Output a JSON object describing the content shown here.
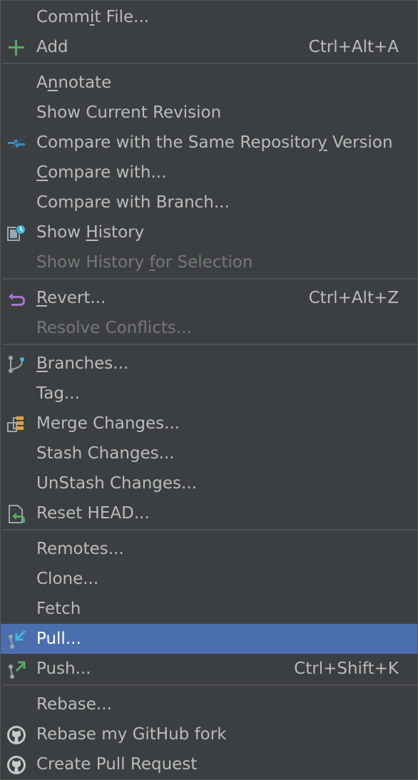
{
  "menu": {
    "commit_file": {
      "label": "Commit File..."
    },
    "add": {
      "label": "Add",
      "shortcut": "Ctrl+Alt+A",
      "icon": "plus-icon"
    },
    "annotate": {
      "label": "Annotate"
    },
    "show_current_revision": {
      "label": "Show Current Revision"
    },
    "compare_same_repo": {
      "label": "Compare with the Same Repository Version",
      "icon": "compare-arrows-icon"
    },
    "compare_with": {
      "label": "Compare with..."
    },
    "compare_with_branch": {
      "label": "Compare with Branch..."
    },
    "show_history": {
      "label": "Show History",
      "icon": "history-icon"
    },
    "show_history_selection": {
      "label": "Show History for Selection",
      "disabled": true
    },
    "revert": {
      "label": "Revert...",
      "shortcut": "Ctrl+Alt+Z",
      "icon": "revert-icon"
    },
    "resolve_conflicts": {
      "label": "Resolve Conflicts...",
      "disabled": true
    },
    "branches": {
      "label": "Branches...",
      "icon": "branch-icon"
    },
    "tag": {
      "label": "Tag..."
    },
    "merge_changes": {
      "label": "Merge Changes...",
      "icon": "merge-icon"
    },
    "stash_changes": {
      "label": "Stash Changes..."
    },
    "unstash_changes": {
      "label": "UnStash Changes..."
    },
    "reset_head": {
      "label": "Reset HEAD...",
      "icon": "reset-icon"
    },
    "remotes": {
      "label": "Remotes..."
    },
    "clone": {
      "label": "Clone..."
    },
    "fetch": {
      "label": "Fetch"
    },
    "pull": {
      "label": "Pull...",
      "selected": true,
      "icon": "pull-icon"
    },
    "push": {
      "label": "Push...",
      "shortcut": "Ctrl+Shift+K",
      "icon": "push-icon"
    },
    "rebase": {
      "label": "Rebase..."
    },
    "rebase_github_fork": {
      "label": "Rebase my GitHub fork",
      "icon": "github-icon"
    },
    "create_pull_request": {
      "label": "Create Pull Request",
      "icon": "github-icon"
    }
  },
  "colors": {
    "background": "#3c3f41",
    "text": "#bbbbbb",
    "disabled_text": "#777777",
    "selection": "#4b6eaf",
    "separator": "#515151"
  }
}
